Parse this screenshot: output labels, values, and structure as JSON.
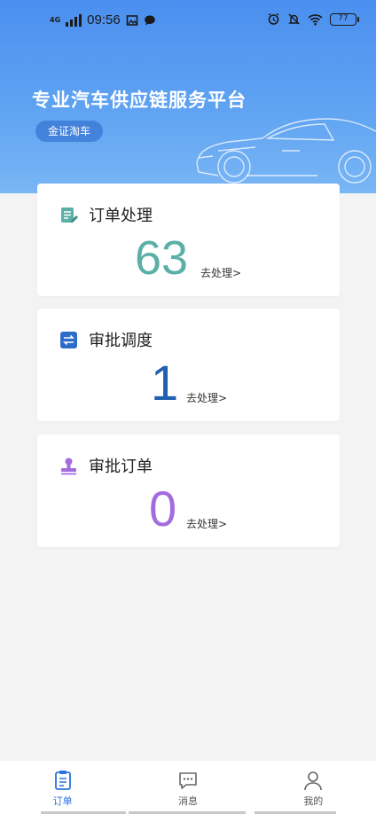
{
  "status_bar": {
    "network": "4G",
    "time": "09:56",
    "battery": "77"
  },
  "header": {
    "title": "专业汽车供应链服务平台",
    "badge": "金证淘车"
  },
  "cards": [
    {
      "title": "订单处理",
      "count": "63",
      "action": "去处理>",
      "icon": "document-edit-icon",
      "color": "#5bb0a6"
    },
    {
      "title": "审批调度",
      "count": "1",
      "action": "去处理>",
      "icon": "swap-arrows-icon",
      "color": "#1f5eb0"
    },
    {
      "title": "审批订单",
      "count": "0",
      "action": "去处理>",
      "icon": "stamp-icon",
      "color": "#a46be0"
    }
  ],
  "tabs": [
    {
      "label": "订单",
      "icon": "clipboard-icon",
      "active": true
    },
    {
      "label": "消息",
      "icon": "chat-bubble-icon",
      "active": false
    },
    {
      "label": "我的",
      "icon": "user-icon",
      "active": false
    }
  ],
  "colors": {
    "accent": "#2a73e0",
    "hero": "#4b8ff0"
  }
}
